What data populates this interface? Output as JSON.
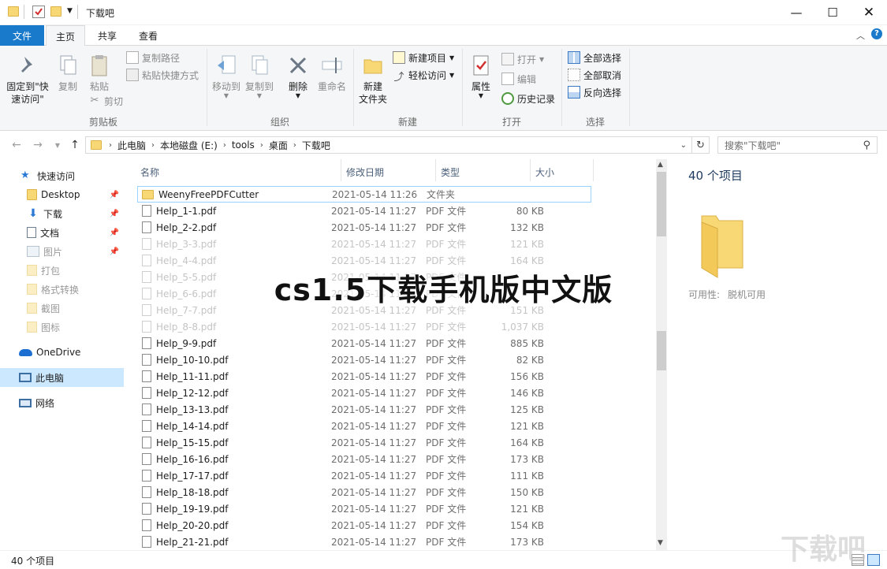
{
  "window": {
    "title": "下载吧"
  },
  "tabs": {
    "file": "文件",
    "home": "主页",
    "share": "共享",
    "view": "查看"
  },
  "ribbon": {
    "clipboard": {
      "label": "剪贴板",
      "pin": "固定到\"快\n速访问\"",
      "copy": "复制",
      "paste": "粘贴",
      "copy_path": "复制路径",
      "paste_shortcut": "粘贴快捷方式",
      "cut": "剪切"
    },
    "organize": {
      "label": "组织",
      "move_to": "移动到",
      "copy_to": "复制到",
      "delete": "删除",
      "rename": "重命名"
    },
    "new": {
      "label": "新建",
      "new_folder": "新建\n文件夹",
      "new_item": "新建项目",
      "easy_access": "轻松访问"
    },
    "open": {
      "label": "打开",
      "properties": "属性",
      "open": "打开",
      "edit": "编辑",
      "history": "历史记录"
    },
    "select": {
      "label": "选择",
      "select_all": "全部选择",
      "select_none": "全部取消",
      "invert": "反向选择"
    }
  },
  "address": {
    "crumbs": [
      "此电脑",
      "本地磁盘 (E:)",
      "tools",
      "桌面",
      "下载吧"
    ],
    "search_placeholder": "搜索\"下载吧\""
  },
  "nav": {
    "quick_access": "快速访问",
    "items": [
      {
        "label": "Desktop",
        "pinned": true
      },
      {
        "label": "下载",
        "pinned": true
      },
      {
        "label": "文档",
        "pinned": true
      },
      {
        "label": "图片",
        "pinned": true
      },
      {
        "label": "打包",
        "pinned": false
      },
      {
        "label": "格式转换",
        "pinned": false
      },
      {
        "label": "截图",
        "pinned": false
      },
      {
        "label": "图标",
        "pinned": false
      }
    ],
    "onedrive": "OneDrive",
    "this_pc": "此电脑",
    "network": "网络"
  },
  "columns": {
    "name": "名称",
    "date": "修改日期",
    "type": "类型",
    "size": "大小"
  },
  "files": [
    {
      "name": "WeenyFreePDFCutter",
      "date": "2021-05-14 11:26",
      "type": "文件夹",
      "size": "",
      "folder": true
    },
    {
      "name": "Help_1-1.pdf",
      "date": "2021-05-14 11:27",
      "type": "PDF 文件",
      "size": "80 KB"
    },
    {
      "name": "Help_2-2.pdf",
      "date": "2021-05-14 11:27",
      "type": "PDF 文件",
      "size": "132 KB"
    },
    {
      "name": "Help_3-3.pdf",
      "date": "2021-05-14 11:27",
      "type": "PDF 文件",
      "size": "121 KB",
      "dim": true
    },
    {
      "name": "Help_4-4.pdf",
      "date": "2021-05-14 11:27",
      "type": "PDF 文件",
      "size": "164 KB",
      "dim": true
    },
    {
      "name": "Help_5-5.pdf",
      "date": "2021-05-14 11:27",
      "type": "PDF 文件",
      "size": "",
      "dim": true
    },
    {
      "name": "Help_6-6.pdf",
      "date": "2021-05-14 11:27",
      "type": "PDF 文件",
      "size": "",
      "dim": true
    },
    {
      "name": "Help_7-7.pdf",
      "date": "2021-05-14 11:27",
      "type": "PDF 文件",
      "size": "151 KB",
      "dim": true
    },
    {
      "name": "Help_8-8.pdf",
      "date": "2021-05-14 11:27",
      "type": "PDF 文件",
      "size": "1,037 KB",
      "dim": true
    },
    {
      "name": "Help_9-9.pdf",
      "date": "2021-05-14 11:27",
      "type": "PDF 文件",
      "size": "885 KB"
    },
    {
      "name": "Help_10-10.pdf",
      "date": "2021-05-14 11:27",
      "type": "PDF 文件",
      "size": "82 KB"
    },
    {
      "name": "Help_11-11.pdf",
      "date": "2021-05-14 11:27",
      "type": "PDF 文件",
      "size": "156 KB"
    },
    {
      "name": "Help_12-12.pdf",
      "date": "2021-05-14 11:27",
      "type": "PDF 文件",
      "size": "146 KB"
    },
    {
      "name": "Help_13-13.pdf",
      "date": "2021-05-14 11:27",
      "type": "PDF 文件",
      "size": "125 KB"
    },
    {
      "name": "Help_14-14.pdf",
      "date": "2021-05-14 11:27",
      "type": "PDF 文件",
      "size": "121 KB"
    },
    {
      "name": "Help_15-15.pdf",
      "date": "2021-05-14 11:27",
      "type": "PDF 文件",
      "size": "164 KB"
    },
    {
      "name": "Help_16-16.pdf",
      "date": "2021-05-14 11:27",
      "type": "PDF 文件",
      "size": "173 KB"
    },
    {
      "name": "Help_17-17.pdf",
      "date": "2021-05-14 11:27",
      "type": "PDF 文件",
      "size": "111 KB"
    },
    {
      "name": "Help_18-18.pdf",
      "date": "2021-05-14 11:27",
      "type": "PDF 文件",
      "size": "150 KB"
    },
    {
      "name": "Help_19-19.pdf",
      "date": "2021-05-14 11:27",
      "type": "PDF 文件",
      "size": "121 KB"
    },
    {
      "name": "Help_20-20.pdf",
      "date": "2021-05-14 11:27",
      "type": "PDF 文件",
      "size": "154 KB"
    },
    {
      "name": "Help_21-21.pdf",
      "date": "2021-05-14 11:27",
      "type": "PDF 文件",
      "size": "173 KB"
    }
  ],
  "details": {
    "count": "40 个项目",
    "availability_label": "可用性:",
    "availability_value": "脱机可用"
  },
  "status": {
    "count": "40 个项目"
  },
  "overlay": {
    "caption": "cs1.5下载手机版中文版",
    "logo_text": "下载吧"
  },
  "colors": {
    "accent": "#1979ca",
    "selected_nav": "#cce8ff",
    "folder": "#f8d775"
  }
}
